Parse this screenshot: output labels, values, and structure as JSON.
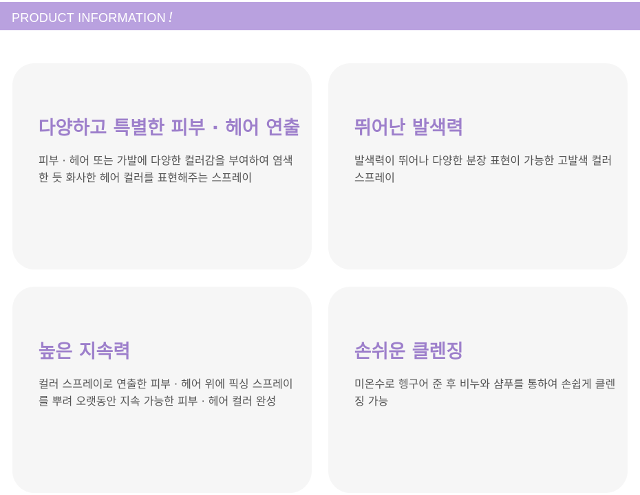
{
  "header": {
    "title": "PRODUCT INFORMATION",
    "exclamation": "!"
  },
  "cards": [
    {
      "title": "다양하고 특별한 피부 · 헤어 연출",
      "description": "피부 · 헤어 또는 가발에 다양한 컬러감을 부여하여 염색 한 듯 화사한 헤어 컬러를 표현해주는 스프레이"
    },
    {
      "title": "뛰어난 발색력",
      "description": "발색력이 뛰어나 다양한 분장 표현이 가능한 고발색 컬러 스프레이"
    },
    {
      "title": "높은 지속력",
      "description": "컬러 스프레이로 연출한 피부 · 헤어 위에 픽싱 스프레이를 뿌려 오랫동안 지속 가능한 피부 · 헤어 컬러 완성"
    },
    {
      "title": "손쉬운 클렌징",
      "description": "미온수로 헹구어 준 후 비누와 샴푸를 통하여 손쉽게 클렌징 가능"
    }
  ],
  "colors": {
    "header_bg": "#b9a1df",
    "accent": "#9d7fcb",
    "card_bg": "#f6f6f6",
    "body_text": "#555555"
  }
}
